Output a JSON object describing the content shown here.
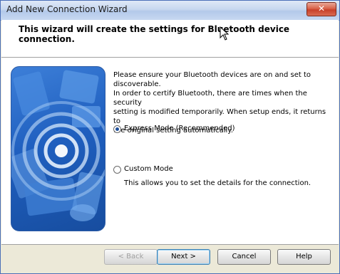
{
  "window": {
    "title": "Add New Connection Wizard",
    "close_label": "✕"
  },
  "header": {
    "text": "This wizard will create the settings for Bluetooth device connection."
  },
  "main": {
    "description_lines": [
      "Please ensure your Bluetooth devices are on and set to",
      "discoverable.",
      "In order to certify Bluetooth, there are times when the security",
      "setting is modified temporarily. When setup ends, it returns to",
      "the original setting automatically."
    ],
    "options": [
      {
        "label": "Express Mode (Recommended)",
        "selected": true
      },
      {
        "label": "Custom Mode",
        "selected": false,
        "description": "This allows you to set the details for the connection."
      }
    ]
  },
  "footer": {
    "back_label": "< Back",
    "next_label": "Next >",
    "cancel_label": "Cancel",
    "help_label": "Help"
  },
  "colors": {
    "illustration_blue": "#1f5fbf",
    "title_bar": "#c6d7ef",
    "close_red": "#c8402a"
  }
}
